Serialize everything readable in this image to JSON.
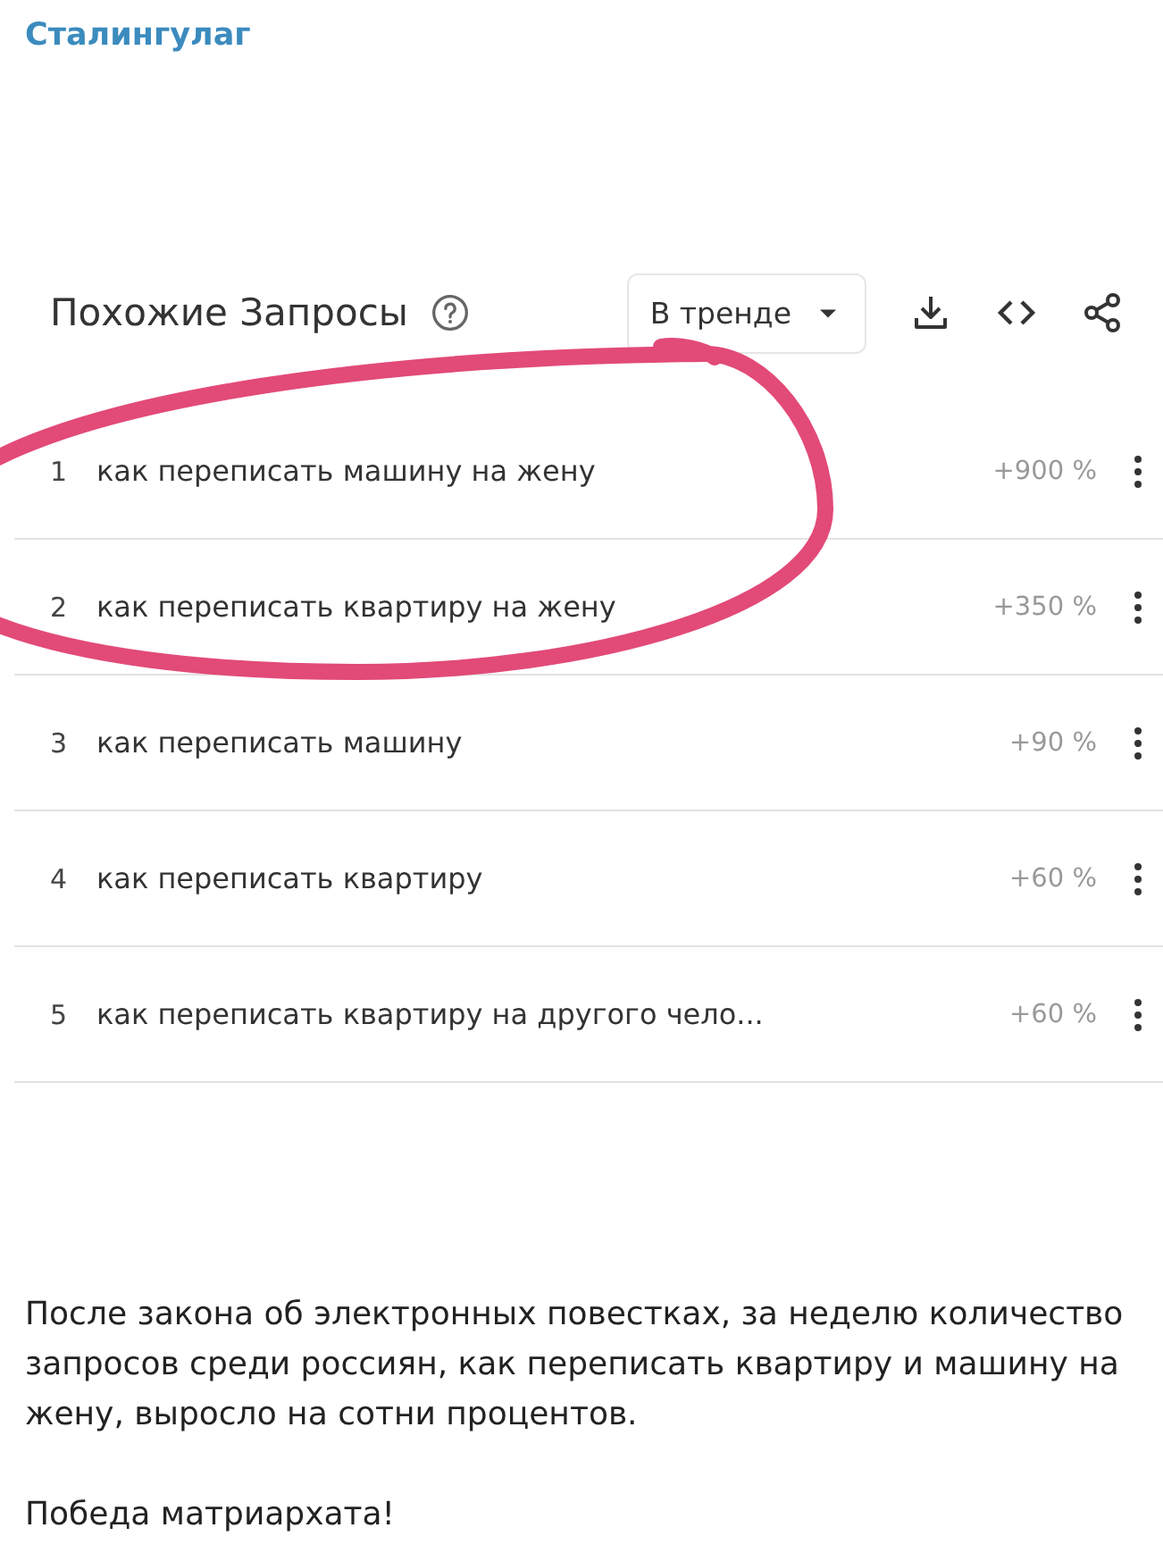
{
  "channel": {
    "name": "Сталингулаг"
  },
  "widget": {
    "title": "Похожие Запросы",
    "filter": {
      "label": "В тренде"
    }
  },
  "rows": [
    {
      "rank": "1",
      "query": "как переписать машину на жену",
      "change": "+900 %"
    },
    {
      "rank": "2",
      "query": "как переписать квартиру на жену",
      "change": "+350 %"
    },
    {
      "rank": "3",
      "query": "как переписать машину",
      "change": "+90 %"
    },
    {
      "rank": "4",
      "query": "как переписать квартиру",
      "change": "+60 %"
    },
    {
      "rank": "5",
      "query": "как переписать квартиру на другого чело...",
      "change": "+60 %"
    }
  ],
  "post": {
    "paragraphs": [
      "После закона об электронных повестках, за неделю количество запросов среди россиян, как переписать квартиру и машину на жену, выросло на сотни процентов.",
      "Победа матриархата!"
    ]
  }
}
